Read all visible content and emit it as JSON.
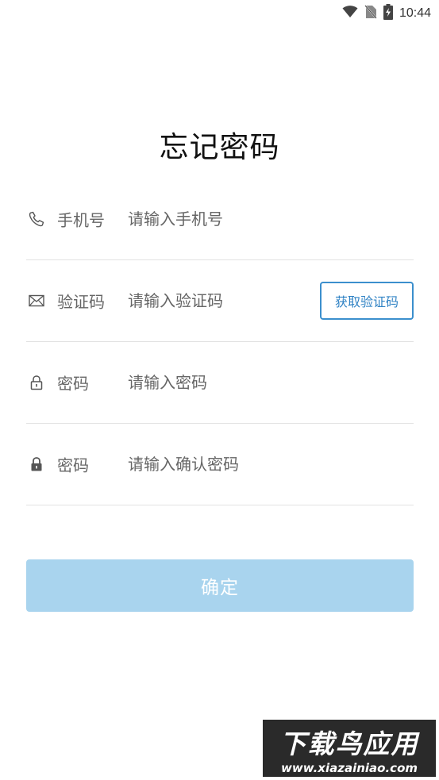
{
  "status_bar": {
    "time": "10:44",
    "icons": [
      "wifi-icon",
      "no-sim-icon",
      "battery-charging-icon"
    ]
  },
  "page": {
    "title": "忘记密码"
  },
  "form": {
    "phone": {
      "icon": "phone-icon",
      "label": "手机号",
      "placeholder": "请输入手机号"
    },
    "code": {
      "icon": "mail-icon",
      "label": "验证码",
      "placeholder": "请输入验证码",
      "button_label": "获取验证码"
    },
    "password": {
      "icon": "lock-open-icon",
      "label": "密码",
      "placeholder": "请输入密码"
    },
    "confirm_password": {
      "icon": "lock-icon",
      "label": "密码",
      "placeholder": "请输入确认密码"
    }
  },
  "actions": {
    "confirm_label": "确定"
  },
  "watermark": {
    "title": "下载鸟应用",
    "url": "www.xiazainiao.com"
  },
  "colors": {
    "accent": "#3b8fcd",
    "confirm_button_bg": "#a9d4ee",
    "divider": "#e2e2e2"
  }
}
